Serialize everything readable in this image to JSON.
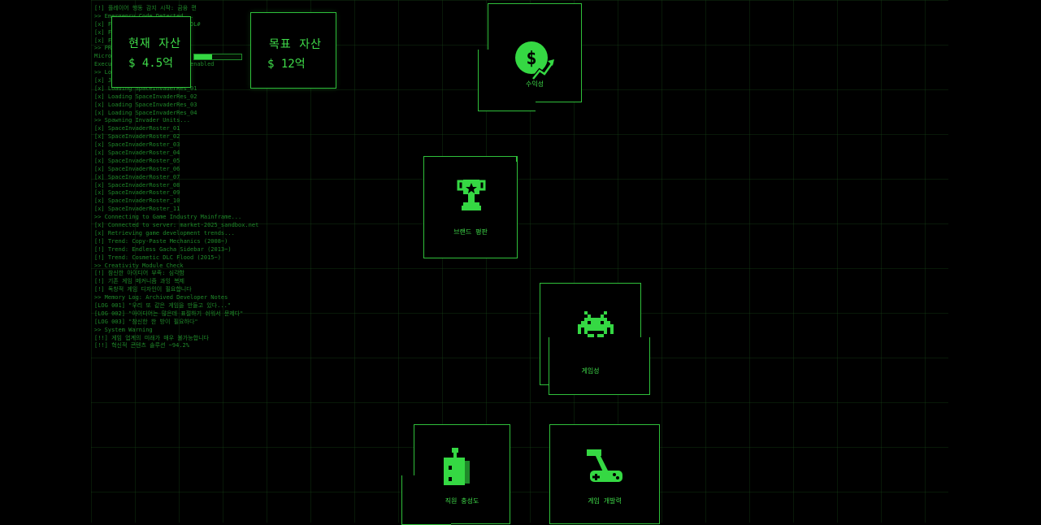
{
  "log_lines": [
    "[!] 플레이어 행동 감지 시작: 금융 편",
    ">> Emergency Code Detected...",
    "[x] Found Emergency Node ...DL#",
    "[x] Fake ... exported..",
    "[x] Fake ... exported..",
    ">> PRE ... DONE",
    "Micro ... ...",
    "Executing ... ...tions, All enabled",
    ">> Loading ... ... ...",
    "[x] Ja ... ... ... encodes",
    "[x] Loading SpaceInvaderRes_01",
    "[x] Loading SpaceInvaderRes_02",
    "[x] Loading SpaceInvaderRes_03",
    "[x] Loading SpaceInvaderRes_04",
    ">> Spawning Invader Units...",
    "[x] SpaceInvaderRoster_01",
    "[x] SpaceInvaderRoster_02",
    "[x] SpaceInvaderRoster_03",
    "[x] SpaceInvaderRoster_04",
    "[x] SpaceInvaderRoster_05",
    "[x] SpaceInvaderRoster_06",
    "[x] SpaceInvaderRoster_07",
    "[x] SpaceInvaderRoster_08",
    "[x] SpaceInvaderRoster_09",
    "[x] SpaceInvaderRoster_10",
    "[x] SpaceInvaderRoster_11",
    ">> Connecting to Game Industry Mainframe...",
    "[x] Connected to server: market-2025_sandbox.net",
    "[x] Retrieving game development trends...",
    "[!] Trend: Copy-Paste Mechanics (2008~)",
    "[!] Trend: Endless Gacha Sidebar (2013~)",
    "[!] Trend: Cosmetic DLC Flood (2015~)",
    ">> Creativity Module Check",
    "[!] 참신한 아이디어 부족: 심각함",
    "[!] 기존 게임 메커니즘 과잉 복제",
    "[!] 독창적 게임 디자인이 필요합니다",
    ">> Memory Log: Archived Developer Notes",
    "[LOG 001] \"우리 또 같은 게임을 만들고 있다...\"",
    "[LOG 002] \"아이디어는 많은데 표절하기 쉬워서 문제다\"",
    "[LOG 003] \"참신한 한 방이 필요하다\"",
    ">> System Warning",
    "[!!] 게임 업계의 미래가 매우 불가능합니다",
    "[!!] 혁신적 콘텐츠 솔루션 ~94.2%"
  ],
  "assets": {
    "current_label": "현재 자산",
    "current_value": "$ 4.5억",
    "target_label": "목표 자산",
    "target_value": "$ 12억",
    "progress_percent": 37.5
  },
  "cards": {
    "revenue": "수익성",
    "brand": "브랜드 평판",
    "games": "게임성",
    "loyalty": "직원 충성도",
    "dev": "게임 개발력"
  },
  "colors": {
    "accent": "#2fbf3a",
    "bright": "#3fdc4a",
    "dim": "#1f8a2a",
    "background": "#000000"
  },
  "icons": {
    "revenue": "dollar-coin-chart-icon",
    "brand": "trophy-icon",
    "games": "space-invader-icon",
    "loyalty": "robot-box-icon",
    "dev": "hammer-gamepad-icon"
  }
}
